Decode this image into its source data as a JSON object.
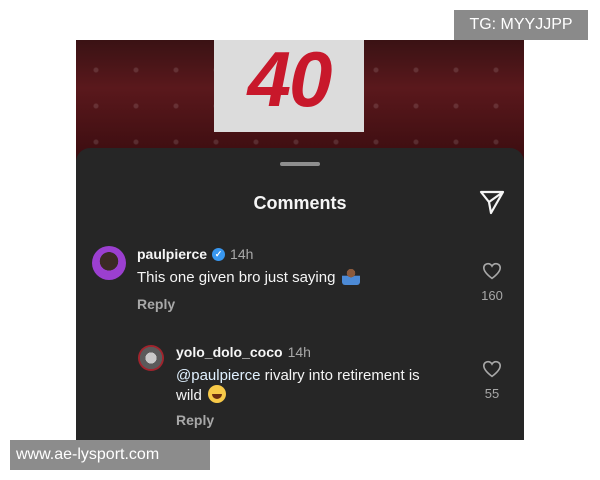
{
  "background": {
    "jersey_number": "40"
  },
  "sheet": {
    "title": "Comments",
    "send_icon": "paper-plane-icon"
  },
  "comments": [
    {
      "username": "paulpierce",
      "verified": true,
      "time": "14h",
      "text": "This one given bro just saying",
      "emoji": "person-shrugging",
      "reply_label": "Reply",
      "likes": "160"
    },
    {
      "username": "yolo_dolo_coco",
      "verified": false,
      "time": "14h",
      "mention": "@paulpierce",
      "text": "rivalry into retirement is",
      "text2": "wild",
      "emoji": "face-with-tears-of-joy",
      "reply_label": "Reply",
      "likes": "55"
    }
  ],
  "watermarks": {
    "top": "TG: MYYJJPP",
    "bottom": "www.ae-lysport.com"
  },
  "colors": {
    "sheet_bg": "#262626",
    "verified_blue": "#3897f0",
    "accent_red": "#c8182b"
  }
}
